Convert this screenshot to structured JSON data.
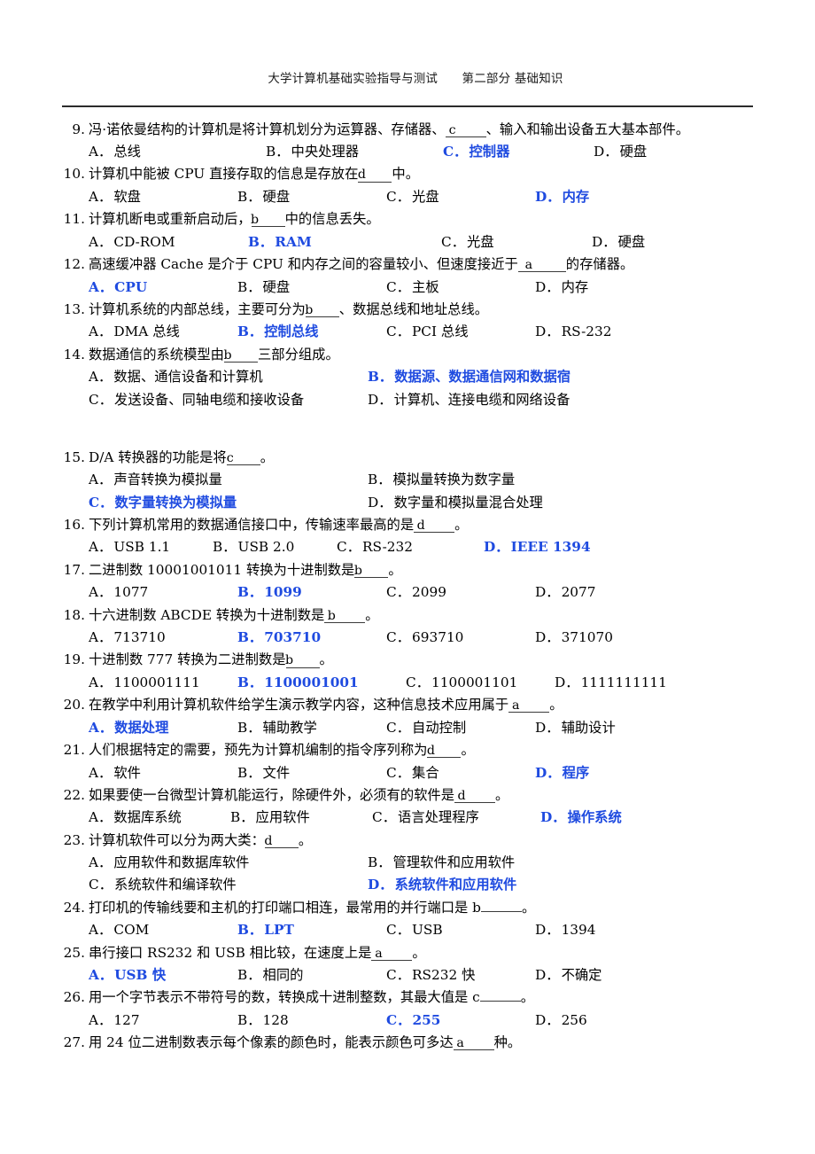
{
  "header": {
    "title": "大学计算机基础实验指导与测试　　第二部分 基础知识"
  },
  "accent_color": "#1F4BE0",
  "questions": [
    {
      "number": "9.",
      "stem_before": "冯·诺依曼结构的计算机是将计算机划分为运算器、存储器、",
      "blank": "c",
      "stem_after": "、输入和输出设备五大基本部件。",
      "options": [
        {
          "label": "A．",
          "text": "总线",
          "correct": false
        },
        {
          "label": "B．",
          "text": "中央处理器",
          "correct": false
        },
        {
          "label": "C．",
          "text": "控制器",
          "correct": true
        },
        {
          "label": "D．",
          "text": "硬盘",
          "correct": false
        }
      ]
    },
    {
      "number": "10.",
      "stem_before": "计算机中能被 CPU 直接存取的信息是存放在",
      "blank": "d",
      "stem_after": "中。",
      "options": [
        {
          "label": "A．",
          "text": "软盘",
          "correct": false
        },
        {
          "label": "B．",
          "text": "硬盘",
          "correct": false
        },
        {
          "label": "C．",
          "text": "光盘",
          "correct": false
        },
        {
          "label": "D．",
          "text": "内存",
          "correct": true
        }
      ]
    },
    {
      "number": "11.",
      "stem_before": "计算机断电或重新启动后，",
      "blank": "b",
      "stem_after": "中的信息丢失。",
      "options": [
        {
          "label": "A．",
          "text": "CD-ROM",
          "correct": false
        },
        {
          "label": "B．",
          "text": "RAM",
          "correct": true
        },
        {
          "label": "C．",
          "text": "光盘",
          "correct": false
        },
        {
          "label": "D．",
          "text": "硬盘",
          "correct": false
        }
      ]
    },
    {
      "number": "12.",
      "stem_before": "高速缓冲器 Cache 是介于 CPU 和内存之间的容量较小、但速度接近于",
      "blank": "a",
      "stem_after": "的存储器。",
      "options": [
        {
          "label": "A．",
          "text": "CPU",
          "correct": true
        },
        {
          "label": "B．",
          "text": "硬盘",
          "correct": false
        },
        {
          "label": "C．",
          "text": "主板",
          "correct": false
        },
        {
          "label": "D．",
          "text": "内存",
          "correct": false
        }
      ]
    },
    {
      "number": "13.",
      "stem_before": "计算机系统的内部总线，主要可分为",
      "blank": "b",
      "stem_after": "、数据总线和地址总线。",
      "options": [
        {
          "label": "A．",
          "text": "DMA 总线",
          "correct": false
        },
        {
          "label": "B．",
          "text": "控制总线",
          "correct": true
        },
        {
          "label": "C．",
          "text": "PCI 总线",
          "correct": false
        },
        {
          "label": "D．",
          "text": "RS-232",
          "correct": false
        }
      ]
    },
    {
      "number": "14.",
      "stem_before": "数据通信的系统模型由",
      "blank": "b",
      "stem_after": "三部分组成。",
      "options": [
        {
          "label": "A．",
          "text": "数据、通信设备和计算机",
          "correct": false
        },
        {
          "label": "B．",
          "text": "数据源、数据通信网和数据宿",
          "correct": true
        },
        {
          "label": "C．",
          "text": "发送设备、同轴电缆和接收设备",
          "correct": false
        },
        {
          "label": "D．",
          "text": "计算机、连接电缆和网络设备",
          "correct": false
        }
      ]
    },
    {
      "number": "15.",
      "stem_before": "D/A 转换器的功能是将",
      "blank": "c",
      "stem_after": "。",
      "options": [
        {
          "label": "A．",
          "text": "声音转换为模拟量",
          "correct": false
        },
        {
          "label": "B．",
          "text": "模拟量转换为数字量",
          "correct": false
        },
        {
          "label": "C．",
          "text": "数字量转换为模拟量",
          "correct": true
        },
        {
          "label": "D．",
          "text": "数字量和模拟量混合处理",
          "correct": false
        }
      ]
    },
    {
      "number": "16.",
      "stem_before": "下列计算机常用的数据通信接口中，传输速率最高的是",
      "blank": "d",
      "stem_after": "。",
      "options": [
        {
          "label": "A．",
          "text": "USB 1.1",
          "correct": false
        },
        {
          "label": "B．",
          "text": "USB 2.0",
          "correct": false
        },
        {
          "label": "C．",
          "text": "RS-232",
          "correct": false
        },
        {
          "label": "D．",
          "text": "IEEE 1394",
          "correct": true
        }
      ]
    },
    {
      "number": "17.",
      "stem_before": "二进制数 10001001011 转换为十进制数是",
      "blank": "b",
      "stem_after": "。",
      "options": [
        {
          "label": "A．",
          "text": "1077",
          "correct": false
        },
        {
          "label": "B．",
          "text": "1099",
          "correct": true
        },
        {
          "label": "C．",
          "text": "2099",
          "correct": false
        },
        {
          "label": "D．",
          "text": "2077",
          "correct": false
        }
      ]
    },
    {
      "number": "18.",
      "stem_before": "十六进制数 ABCDE 转换为十进制数是",
      "blank": "b",
      "stem_after": "。",
      "options": [
        {
          "label": "A．",
          "text": "713710",
          "correct": false
        },
        {
          "label": "B．",
          "text": "703710",
          "correct": true
        },
        {
          "label": "C．",
          "text": "693710",
          "correct": false
        },
        {
          "label": "D．",
          "text": "371070",
          "correct": false
        }
      ]
    },
    {
      "number": "19.",
      "stem_before": "十进制数 777 转换为二进制数是",
      "blank": "b",
      "stem_after": "。",
      "options": [
        {
          "label": "A．",
          "text": "1100001111",
          "correct": false
        },
        {
          "label": "B．",
          "text": "1100001001",
          "correct": true
        },
        {
          "label": "C．",
          "text": "1100001101",
          "correct": false
        },
        {
          "label": "D．",
          "text": "1111111111",
          "correct": false
        }
      ]
    },
    {
      "number": "20.",
      "stem_before": "在教学中利用计算机软件给学生演示教学内容，这种信息技术应用属于",
      "blank": "a",
      "stem_after": "。",
      "options": [
        {
          "label": "A．",
          "text": "数据处理",
          "correct": true
        },
        {
          "label": "B．",
          "text": "辅助教学",
          "correct": false
        },
        {
          "label": "C．",
          "text": "自动控制",
          "correct": false
        },
        {
          "label": "D．",
          "text": "辅助设计",
          "correct": false
        }
      ]
    },
    {
      "number": "21.",
      "stem_before": "人们根据特定的需要，预先为计算机编制的指令序列称为",
      "blank": "d",
      "stem_after": "。",
      "options": [
        {
          "label": "A．",
          "text": "软件",
          "correct": false
        },
        {
          "label": "B．",
          "text": "文件",
          "correct": false
        },
        {
          "label": "C．",
          "text": "集合",
          "correct": false
        },
        {
          "label": "D．",
          "text": "程序",
          "correct": true
        }
      ]
    },
    {
      "number": "22.",
      "stem_before": "如果要使一台微型计算机能运行，除硬件外，必须有的软件是",
      "blank": "d",
      "stem_after": "。",
      "options": [
        {
          "label": "A．",
          "text": "数据库系统",
          "correct": false
        },
        {
          "label": "B．",
          "text": "应用软件",
          "correct": false
        },
        {
          "label": "C．",
          "text": "语言处理程序",
          "correct": false
        },
        {
          "label": "D．",
          "text": "操作系统",
          "correct": true
        }
      ]
    },
    {
      "number": "23.",
      "stem_before": "计算机软件可以分为两大类：",
      "blank": "d",
      "stem_after": "。",
      "options": [
        {
          "label": "A．",
          "text": "应用软件和数据库软件",
          "correct": false
        },
        {
          "label": "B．",
          "text": "管理软件和应用软件",
          "correct": false
        },
        {
          "label": "C．",
          "text": "系统软件和编译软件",
          "correct": false
        },
        {
          "label": "D．",
          "text": "系统软件和应用软件",
          "correct": true
        }
      ]
    },
    {
      "number": "24.",
      "stem_before": "打印机的传输线要和主机的打印端口相连，最常用的并行端口是 b",
      "blank": "",
      "stem_after": "。",
      "options": [
        {
          "label": "A．",
          "text": "COM",
          "correct": false
        },
        {
          "label": "B．",
          "text": "LPT",
          "correct": true
        },
        {
          "label": "C．",
          "text": "USB",
          "correct": false
        },
        {
          "label": "D．",
          "text": "1394",
          "correct": false
        }
      ]
    },
    {
      "number": "25.",
      "stem_before": "串行接口 RS232 和 USB 相比较，在速度上是",
      "blank": "a",
      "stem_after": "。",
      "options": [
        {
          "label": "A．",
          "text": "USB 快",
          "correct": true
        },
        {
          "label": "B．",
          "text": "相同的",
          "correct": false
        },
        {
          "label": "C．",
          "text": "RS232 快",
          "correct": false
        },
        {
          "label": "D．",
          "text": "不确定",
          "correct": false
        }
      ]
    },
    {
      "number": "26.",
      "stem_before": "用一个字节表示不带符号的数，转换成十进制整数，其最大值是 c",
      "blank": "",
      "stem_after": "。",
      "options": [
        {
          "label": "A．",
          "text": "127",
          "correct": false
        },
        {
          "label": "B．",
          "text": "128",
          "correct": false
        },
        {
          "label": "C．",
          "text": "255",
          "correct": true
        },
        {
          "label": "D．",
          "text": "256",
          "correct": false
        }
      ]
    },
    {
      "number": "27.",
      "stem_before": "用 24 位二进制数表示每个像素的颜色时，能表示颜色可多达",
      "blank": "a",
      "stem_after": "种。",
      "options": []
    }
  ]
}
